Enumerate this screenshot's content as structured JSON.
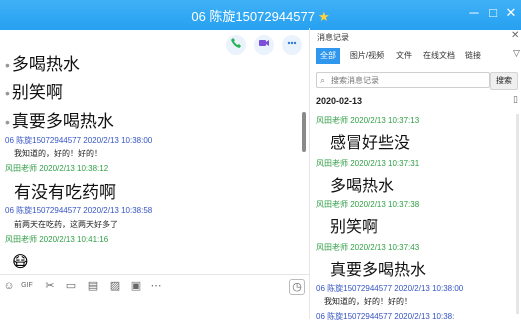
{
  "window": {
    "title": "06 陈旋15072944577",
    "star": "★",
    "controls": [
      "─",
      "□",
      "✕"
    ]
  },
  "chat": {
    "action_icons": [
      "phone-icon",
      "video-icon",
      "more-icon"
    ],
    "messages": [
      {
        "type": "big",
        "bullet": "•",
        "text": "多喝热水"
      },
      {
        "type": "big",
        "bullet": "•",
        "text": "别笑啊"
      },
      {
        "type": "big",
        "bullet": "•",
        "text": "真要多喝热水"
      },
      {
        "type": "header",
        "color": "blue",
        "text": "06 陈旋15072944577 2020/2/13 10:38:00"
      },
      {
        "type": "small",
        "text": "我知道的，好的！好的！"
      },
      {
        "type": "header",
        "color": "green",
        "text": "风田老师 2020/2/13 10:38:12"
      },
      {
        "type": "big",
        "text": "有没有吃药啊"
      },
      {
        "type": "header",
        "color": "blue",
        "text": "06 陈旋15072944577 2020/2/13 10:38:58"
      },
      {
        "type": "small",
        "text": "前两天在吃药，这两天好多了"
      },
      {
        "type": "header",
        "color": "green",
        "text": "风田老师 2020/2/13 10:41:16"
      },
      {
        "type": "emoji",
        "text": "😷"
      }
    ],
    "toolbar_icons": [
      "emoji-icon",
      "gif-icon",
      "scissors-icon",
      "folder-icon",
      "doc-icon",
      "image-icon",
      "screenshot-icon",
      "more-icon",
      "history-icon"
    ],
    "toolbar_glyphs": [
      "☺",
      "GIF",
      "✂",
      "▭",
      "▤",
      "▨",
      "▣",
      "⋯",
      "◷"
    ]
  },
  "history": {
    "title": "消息记录",
    "close": "✕",
    "tabs": [
      "全部",
      "图片/视频",
      "文件",
      "在线文档",
      "链接"
    ],
    "active_tab": 0,
    "filter": "▽",
    "search_placeholder": "搜索消息记录",
    "search_button": "搜索",
    "date": "2020-02-13",
    "calendar": "▯",
    "messages": [
      {
        "header": "风田老师 2020/2/13 10:37:13",
        "color": "green",
        "text": "感冒好些没",
        "style": "big"
      },
      {
        "header": "风田老师 2020/2/13 10:37:31",
        "color": "green",
        "text": "多喝热水",
        "style": "big"
      },
      {
        "header": "风田老师 2020/2/13 10:37:38",
        "color": "green",
        "text": "别笑啊",
        "style": "big"
      },
      {
        "header": "风田老师 2020/2/13 10:37:43",
        "color": "green",
        "text": "真要多喝热水",
        "style": "big"
      },
      {
        "header": "06 陈旋15072944577 2020/2/13 10:38:00",
        "color": "blue",
        "text": "我知道的，好的！好的！",
        "style": "small"
      },
      {
        "header": "06 陈旋15072944577 2020/2/13 10:38:",
        "color": "blue",
        "text": "",
        "style": "small"
      }
    ]
  },
  "colors": {
    "titlebar": "#2aa3f3",
    "tab_active": "#2f97ee",
    "sender_blue": "#3554c4",
    "sender_green": "#2f9e44"
  }
}
